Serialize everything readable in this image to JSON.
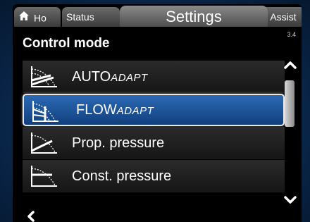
{
  "tabs": {
    "home": {
      "label": "Ho",
      "icon": "home-icon"
    },
    "status": {
      "label": "Status"
    },
    "settings": {
      "label": "Settings"
    },
    "assist": {
      "label": "Assist"
    }
  },
  "page_number": "3.4",
  "section_title": "Control mode",
  "items": [
    {
      "label": "AUTO",
      "suffix": "ADAPT",
      "icon": "autoadapt-curve-icon",
      "selected": false
    },
    {
      "label": "FLOW",
      "suffix": "ADAPT",
      "icon": "flowadapt-curve-icon",
      "selected": true
    },
    {
      "label": "Prop. pressure",
      "suffix": "",
      "icon": "proportional-pressure-curve-icon",
      "selected": false
    },
    {
      "label": "Const. pressure",
      "suffix": "",
      "icon": "constant-pressure-curve-icon",
      "selected": false
    }
  ],
  "scrollbar": {
    "position_fraction": 0.05,
    "visible_fraction": 0.4
  },
  "colors": {
    "selected_bg": "#1e5aa4",
    "selected_border": "#e9e9e9",
    "tab_bg": "#5a5a5a",
    "background": "#0b2a4e"
  },
  "icons": {
    "back": "chevron-left-icon",
    "scroll_up": "chevron-up-icon",
    "scroll_down": "chevron-down-icon"
  }
}
